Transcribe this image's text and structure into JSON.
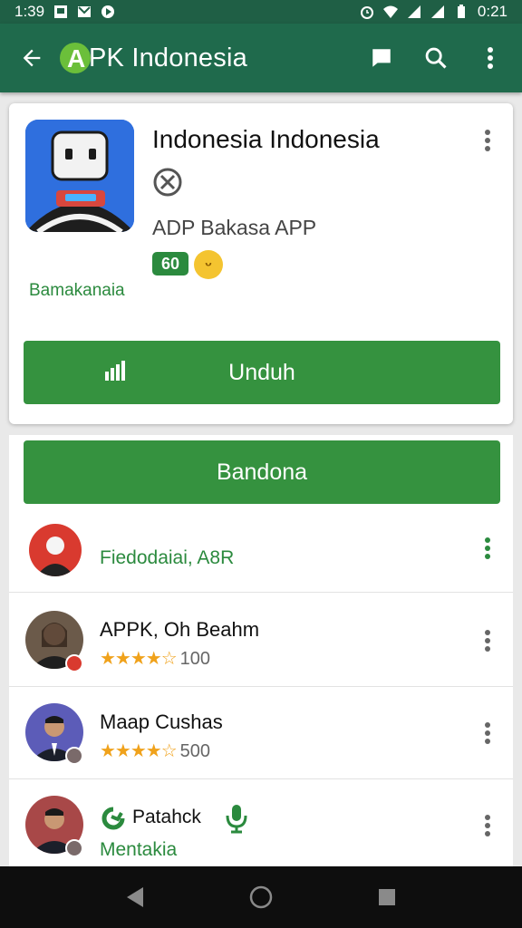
{
  "status": {
    "time_left": "1:39",
    "time_right": "0:21"
  },
  "appbar": {
    "logo_letter": "A",
    "title": "PK Indonesia"
  },
  "app": {
    "name": "Indonesia Indonesia",
    "developer": "ADP Bakasa APP",
    "rating_badge": "60",
    "category": "Bamakanaia",
    "install_label": "Unduh"
  },
  "list": {
    "header_button": "Bandona",
    "items": [
      {
        "name": "Fiedodaiai, A8R",
        "stars": "★★★★☆",
        "count": ""
      },
      {
        "name": "APPK, Oh Beahm",
        "stars": "★★★★☆",
        "count": "100"
      },
      {
        "name": "Maap Cushas",
        "stars": "★★★★☆",
        "count": "500"
      },
      {
        "name": "Patahck",
        "subtitle": "Mentakia"
      }
    ]
  },
  "colors": {
    "primary": "#1f6a4c",
    "accent": "#35923f",
    "star": "#f0a21b"
  }
}
